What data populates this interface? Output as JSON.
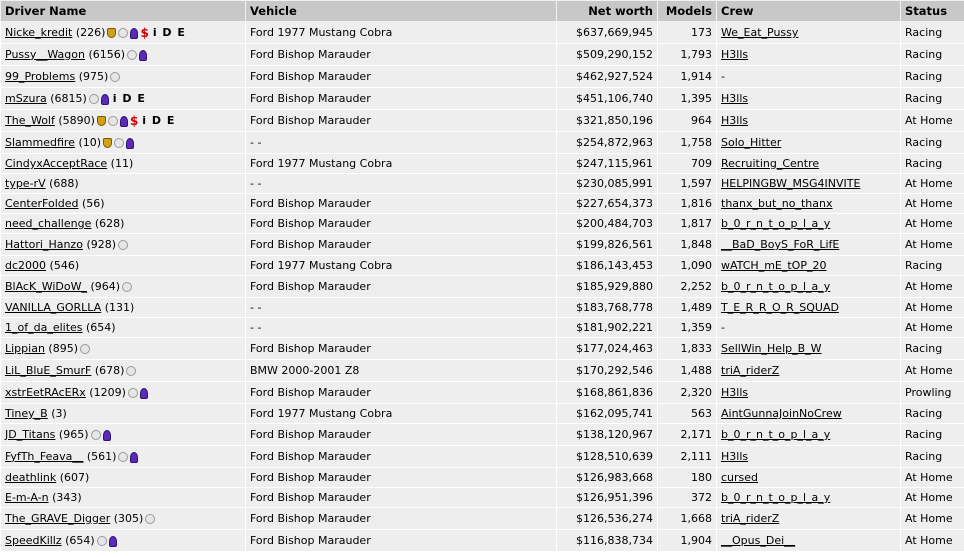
{
  "headers": {
    "driver": "Driver Name",
    "vehicle": "Vehicle",
    "networth": "Net worth",
    "models": "Models",
    "crew": "Crew",
    "status": "Status"
  },
  "ide_text": "i D E",
  "dollar_text": "$",
  "rows": [
    {
      "name": "Nicke_kredit",
      "level": "(226)",
      "icons": [
        "trophy",
        "grey",
        "ribbon",
        "dollar"
      ],
      "ide": true,
      "vehicle": "Ford 1977 Mustang Cobra",
      "networth": "$637,669,945",
      "models": "173",
      "crew": "We_Eat_Pussy",
      "status": "Racing"
    },
    {
      "name": "Pussy__Wagon",
      "level": "(6156)",
      "icons": [
        "grey",
        "ribbon"
      ],
      "ide": false,
      "vehicle": "Ford Bishop Marauder",
      "networth": "$509,290,152",
      "models": "1,793",
      "crew": "H3lls",
      "status": "Racing"
    },
    {
      "name": "99_Problems",
      "level": "(975)",
      "icons": [
        "grey"
      ],
      "ide": false,
      "vehicle": "Ford Bishop Marauder",
      "networth": "$462,927,524",
      "models": "1,914",
      "crew": "-",
      "status": "Racing"
    },
    {
      "name": "mSzura",
      "level": "(6815)",
      "icons": [
        "grey",
        "ribbon"
      ],
      "ide": true,
      "vehicle": "Ford Bishop Marauder",
      "networth": "$451,106,740",
      "models": "1,395",
      "crew": "H3lls",
      "status": "Racing"
    },
    {
      "name": "The_Wolf",
      "level": "(5890)",
      "icons": [
        "trophy",
        "grey",
        "ribbon",
        "dollar"
      ],
      "ide": true,
      "vehicle": "Ford Bishop Marauder",
      "networth": "$321,850,196",
      "models": "964",
      "crew": "H3lls",
      "status": "At Home"
    },
    {
      "name": "Slammedfire",
      "level": "(10)",
      "icons": [
        "trophy",
        "grey",
        "ribbon"
      ],
      "ide": false,
      "vehicle": "- -",
      "networth": "$254,872,963",
      "models": "1,758",
      "crew": "Solo_Hitter",
      "status": "Racing"
    },
    {
      "name": "CindyxAcceptRace",
      "level": "(11)",
      "icons": [],
      "ide": false,
      "vehicle": "Ford 1977 Mustang Cobra",
      "networth": "$247,115,961",
      "models": "709",
      "crew": "Recruiting_Centre",
      "status": "Racing"
    },
    {
      "name": "type-rV",
      "level": "(688)",
      "icons": [],
      "ide": false,
      "vehicle": "- -",
      "networth": "$230,085,991",
      "models": "1,597",
      "crew": "HELPINGBW_MSG4INVITE",
      "status": "At Home"
    },
    {
      "name": "CenterFolded",
      "level": "(56)",
      "icons": [],
      "ide": false,
      "vehicle": "Ford Bishop Marauder",
      "networth": "$227,654,373",
      "models": "1,816",
      "crew": "thanx_but_no_thanx",
      "status": "At Home"
    },
    {
      "name": "need_challenge",
      "level": "(628)",
      "icons": [],
      "ide": false,
      "vehicle": "Ford Bishop Marauder",
      "networth": "$200,484,703",
      "models": "1,817",
      "crew": "b_0_r_n_t_o_p_l_a_y",
      "status": "At Home"
    },
    {
      "name": "Hattori_Hanzo",
      "level": "(928)",
      "icons": [
        "grey"
      ],
      "ide": false,
      "vehicle": "Ford Bishop Marauder",
      "networth": "$199,826,561",
      "models": "1,848",
      "crew": "__BaD_BoyS_FoR_LifE",
      "status": "At Home"
    },
    {
      "name": "dc2000",
      "level": "(546)",
      "icons": [],
      "ide": false,
      "vehicle": "Ford 1977 Mustang Cobra",
      "networth": "$186,143,453",
      "models": "1,090",
      "crew": "wATCH_mE_tOP_20",
      "status": "Racing"
    },
    {
      "name": "BlAcK_WiDoW_",
      "level": "(964)",
      "icons": [
        "grey"
      ],
      "ide": false,
      "vehicle": "Ford Bishop Marauder",
      "networth": "$185,929,880",
      "models": "2,252",
      "crew": "b_0_r_n_t_o_p_l_a_y",
      "status": "At Home"
    },
    {
      "name": "VANILLA_GORLLA",
      "level": "(131)",
      "icons": [],
      "ide": false,
      "vehicle": "- -",
      "networth": "$183,768,778",
      "models": "1,489",
      "crew": "T_E_R_R_O_R_SQUAD",
      "status": "At Home"
    },
    {
      "name": "1_of_da_elites",
      "level": "(654)",
      "icons": [],
      "ide": false,
      "vehicle": "- -",
      "networth": "$181,902,221",
      "models": "1,359",
      "crew": "-",
      "status": "At Home"
    },
    {
      "name": "Lippian",
      "level": "(895)",
      "icons": [
        "grey"
      ],
      "ide": false,
      "vehicle": "Ford Bishop Marauder",
      "networth": "$177,024,463",
      "models": "1,833",
      "crew": "SellWin_Help_B_W",
      "status": "Racing"
    },
    {
      "name": "LiL_BluE_SmurF",
      "level": "(678)",
      "icons": [
        "grey"
      ],
      "ide": false,
      "vehicle": "BMW 2000-2001 Z8",
      "networth": "$170,292,546",
      "models": "1,488",
      "crew": "triA_riderZ",
      "status": "At Home"
    },
    {
      "name": "xstrEetRAcERx",
      "level": "(1209)",
      "icons": [
        "grey",
        "ribbon"
      ],
      "ide": false,
      "vehicle": "Ford Bishop Marauder",
      "networth": "$168,861,836",
      "models": "2,320",
      "crew": "H3lls",
      "status": "Prowling"
    },
    {
      "name": "Tiney_B",
      "level": "(3)",
      "icons": [],
      "ide": false,
      "vehicle": "Ford 1977 Mustang Cobra",
      "networth": "$162,095,741",
      "models": "563",
      "crew": "AintGunnaJoinNoCrew",
      "status": "Racing"
    },
    {
      "name": "JD_Titans",
      "level": "(965)",
      "icons": [
        "grey",
        "ribbon"
      ],
      "ide": false,
      "vehicle": "Ford Bishop Marauder",
      "networth": "$138,120,967",
      "models": "2,171",
      "crew": "b_0_r_n_t_o_p_l_a_y",
      "status": "Racing"
    },
    {
      "name": "FyfTh_Feava__",
      "level": "(561)",
      "icons": [
        "grey",
        "ribbon"
      ],
      "ide": false,
      "vehicle": "Ford Bishop Marauder",
      "networth": "$128,510,639",
      "models": "2,111",
      "crew": "H3lls",
      "status": "Racing"
    },
    {
      "name": "deathlink",
      "level": "(607)",
      "icons": [],
      "ide": false,
      "vehicle": "Ford Bishop Marauder",
      "networth": "$126,983,668",
      "models": "180",
      "crew": "cursed",
      "status": "At Home"
    },
    {
      "name": "E-m-A-n",
      "level": "(343)",
      "icons": [],
      "ide": false,
      "vehicle": "Ford Bishop Marauder",
      "networth": "$126,951,396",
      "models": "372",
      "crew": "b_0_r_n_t_o_p_l_a_y",
      "status": "At Home"
    },
    {
      "name": "The_GRAVE_Digger",
      "level": "(305)",
      "icons": [
        "grey"
      ],
      "ide": false,
      "vehicle": "Ford Bishop Marauder",
      "networth": "$126,536,274",
      "models": "1,668",
      "crew": "triA_riderZ",
      "status": "At Home"
    },
    {
      "name": "SpeedKillz",
      "level": "(654)",
      "icons": [
        "grey",
        "ribbon"
      ],
      "ide": false,
      "vehicle": "Ford Bishop Marauder",
      "networth": "$116,838,734",
      "models": "1,904",
      "crew": "__Opus_Dei__",
      "status": "At Home"
    }
  ]
}
